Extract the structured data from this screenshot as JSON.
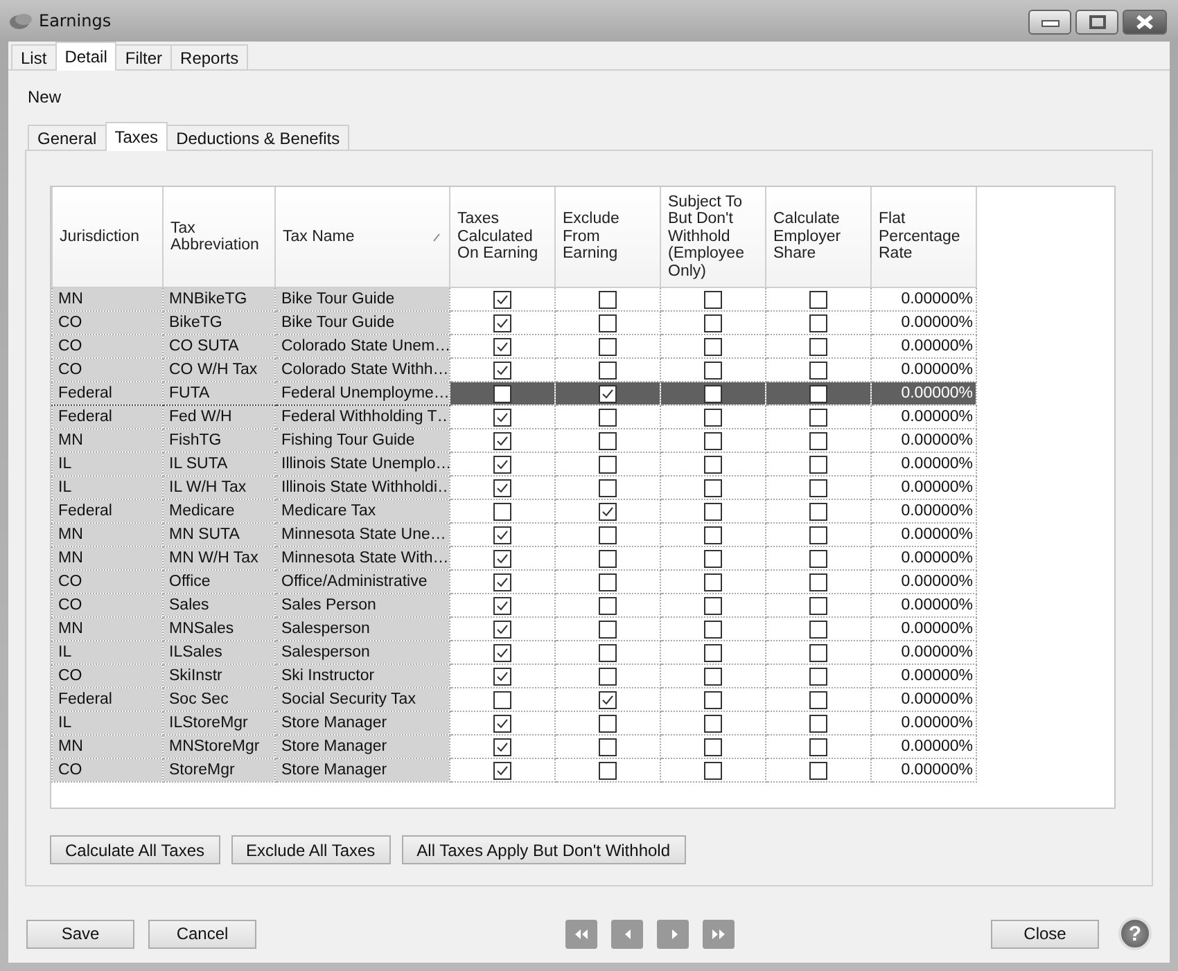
{
  "window": {
    "title": "Earnings"
  },
  "tabs": [
    {
      "label": "List",
      "selected": false
    },
    {
      "label": "Detail",
      "selected": true
    },
    {
      "label": "Filter",
      "selected": false
    },
    {
      "label": "Reports",
      "selected": false
    }
  ],
  "toolbar": {
    "new_label": "New"
  },
  "subtabs": [
    {
      "label": "General",
      "selected": false
    },
    {
      "label": "Taxes",
      "selected": true
    },
    {
      "label": "Deductions & Benefits",
      "selected": false
    }
  ],
  "table": {
    "columns": [
      {
        "label": "Jurisdiction",
        "kind": "text"
      },
      {
        "label": "Tax Abbreviation",
        "kind": "text"
      },
      {
        "label": "Tax Name",
        "kind": "text",
        "sorted": true
      },
      {
        "label": "Taxes Calculated On Earning",
        "kind": "check"
      },
      {
        "label": "Exclude From Earning",
        "kind": "check"
      },
      {
        "label": "Subject To But Don't Withhold (Employee Only)",
        "kind": "check"
      },
      {
        "label": "Calculate Employer Share",
        "kind": "check"
      },
      {
        "label": "Flat Percentage Rate",
        "kind": "number"
      }
    ],
    "rows": [
      {
        "selected": false,
        "cells": [
          "MN",
          "MNBikeTG",
          "Bike Tour Guide",
          true,
          false,
          false,
          false,
          "0.00000%"
        ]
      },
      {
        "selected": false,
        "cells": [
          "CO",
          "BikeTG",
          "Bike Tour Guide",
          true,
          false,
          false,
          false,
          "0.00000%"
        ]
      },
      {
        "selected": false,
        "cells": [
          "CO",
          "CO SUTA",
          "Colorado State Unem…",
          true,
          false,
          false,
          false,
          "0.00000%"
        ]
      },
      {
        "selected": false,
        "cells": [
          "CO",
          "CO W/H Tax",
          "Colorado State Withh…",
          true,
          false,
          false,
          false,
          "0.00000%"
        ]
      },
      {
        "selected": true,
        "cells": [
          "Federal",
          "FUTA",
          "Federal Unemployme…",
          false,
          true,
          false,
          false,
          "0.00000%"
        ]
      },
      {
        "selected": false,
        "cells": [
          "Federal",
          "Fed W/H",
          "Federal Withholding T…",
          true,
          false,
          false,
          false,
          "0.00000%"
        ]
      },
      {
        "selected": false,
        "cells": [
          "MN",
          "FishTG",
          "Fishing Tour Guide",
          true,
          false,
          false,
          false,
          "0.00000%"
        ]
      },
      {
        "selected": false,
        "cells": [
          "IL",
          "IL SUTA",
          "Illinois State Unemplo…",
          true,
          false,
          false,
          false,
          "0.00000%"
        ]
      },
      {
        "selected": false,
        "cells": [
          "IL",
          "IL W/H Tax",
          "Illinois State Withholdi…",
          true,
          false,
          false,
          false,
          "0.00000%"
        ]
      },
      {
        "selected": false,
        "cells": [
          "Federal",
          "Medicare",
          "Medicare Tax",
          false,
          true,
          false,
          false,
          "0.00000%"
        ]
      },
      {
        "selected": false,
        "cells": [
          "MN",
          "MN SUTA",
          "Minnesota State Une…",
          true,
          false,
          false,
          false,
          "0.00000%"
        ]
      },
      {
        "selected": false,
        "cells": [
          "MN",
          "MN W/H Tax",
          "Minnesota State With…",
          true,
          false,
          false,
          false,
          "0.00000%"
        ]
      },
      {
        "selected": false,
        "cells": [
          "CO",
          "Office",
          "Office/Administrative",
          true,
          false,
          false,
          false,
          "0.00000%"
        ]
      },
      {
        "selected": false,
        "cells": [
          "CO",
          "Sales",
          "Sales Person",
          true,
          false,
          false,
          false,
          "0.00000%"
        ]
      },
      {
        "selected": false,
        "cells": [
          "MN",
          "MNSales",
          "Salesperson",
          true,
          false,
          false,
          false,
          "0.00000%"
        ]
      },
      {
        "selected": false,
        "cells": [
          "IL",
          "ILSales",
          "Salesperson",
          true,
          false,
          false,
          false,
          "0.00000%"
        ]
      },
      {
        "selected": false,
        "cells": [
          "CO",
          "SkiInstr",
          "Ski Instructor",
          true,
          false,
          false,
          false,
          "0.00000%"
        ]
      },
      {
        "selected": false,
        "cells": [
          "Federal",
          "Soc Sec",
          "Social Security Tax",
          false,
          true,
          false,
          false,
          "0.00000%"
        ]
      },
      {
        "selected": false,
        "cells": [
          "IL",
          "ILStoreMgr",
          "Store Manager",
          true,
          false,
          false,
          false,
          "0.00000%"
        ]
      },
      {
        "selected": false,
        "cells": [
          "MN",
          "MNStoreMgr",
          "Store Manager",
          true,
          false,
          false,
          false,
          "0.00000%"
        ]
      },
      {
        "selected": false,
        "cells": [
          "CO",
          "StoreMgr",
          "Store Manager",
          true,
          false,
          false,
          false,
          "0.00000%"
        ]
      }
    ]
  },
  "panel_buttons": [
    "Calculate All Taxes",
    "Exclude All Taxes",
    "All Taxes Apply But Don't Withhold"
  ],
  "footer": {
    "left_buttons": [
      "Save",
      "Cancel"
    ],
    "close_label": "Close",
    "help_glyph": "?"
  }
}
